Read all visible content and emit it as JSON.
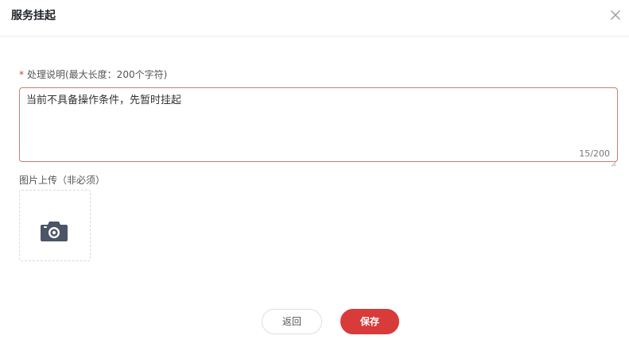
{
  "dialog": {
    "title": "服务挂起",
    "close_icon": "close-icon"
  },
  "form": {
    "required_mark": "*",
    "description_label": "处理说明(最大长度：200个字符)",
    "description_value": "当前不具备操作条件，先暂时挂起",
    "char_counter": "15/200",
    "upload_label": "图片上传（非必须）",
    "upload_icon": "camera-icon"
  },
  "footer": {
    "back_label": "返回",
    "save_label": "保存"
  },
  "colors": {
    "required": "#d7412f",
    "primary": "#d93a3a",
    "textarea_border": "#c9806f",
    "icon": "#4a5568"
  }
}
